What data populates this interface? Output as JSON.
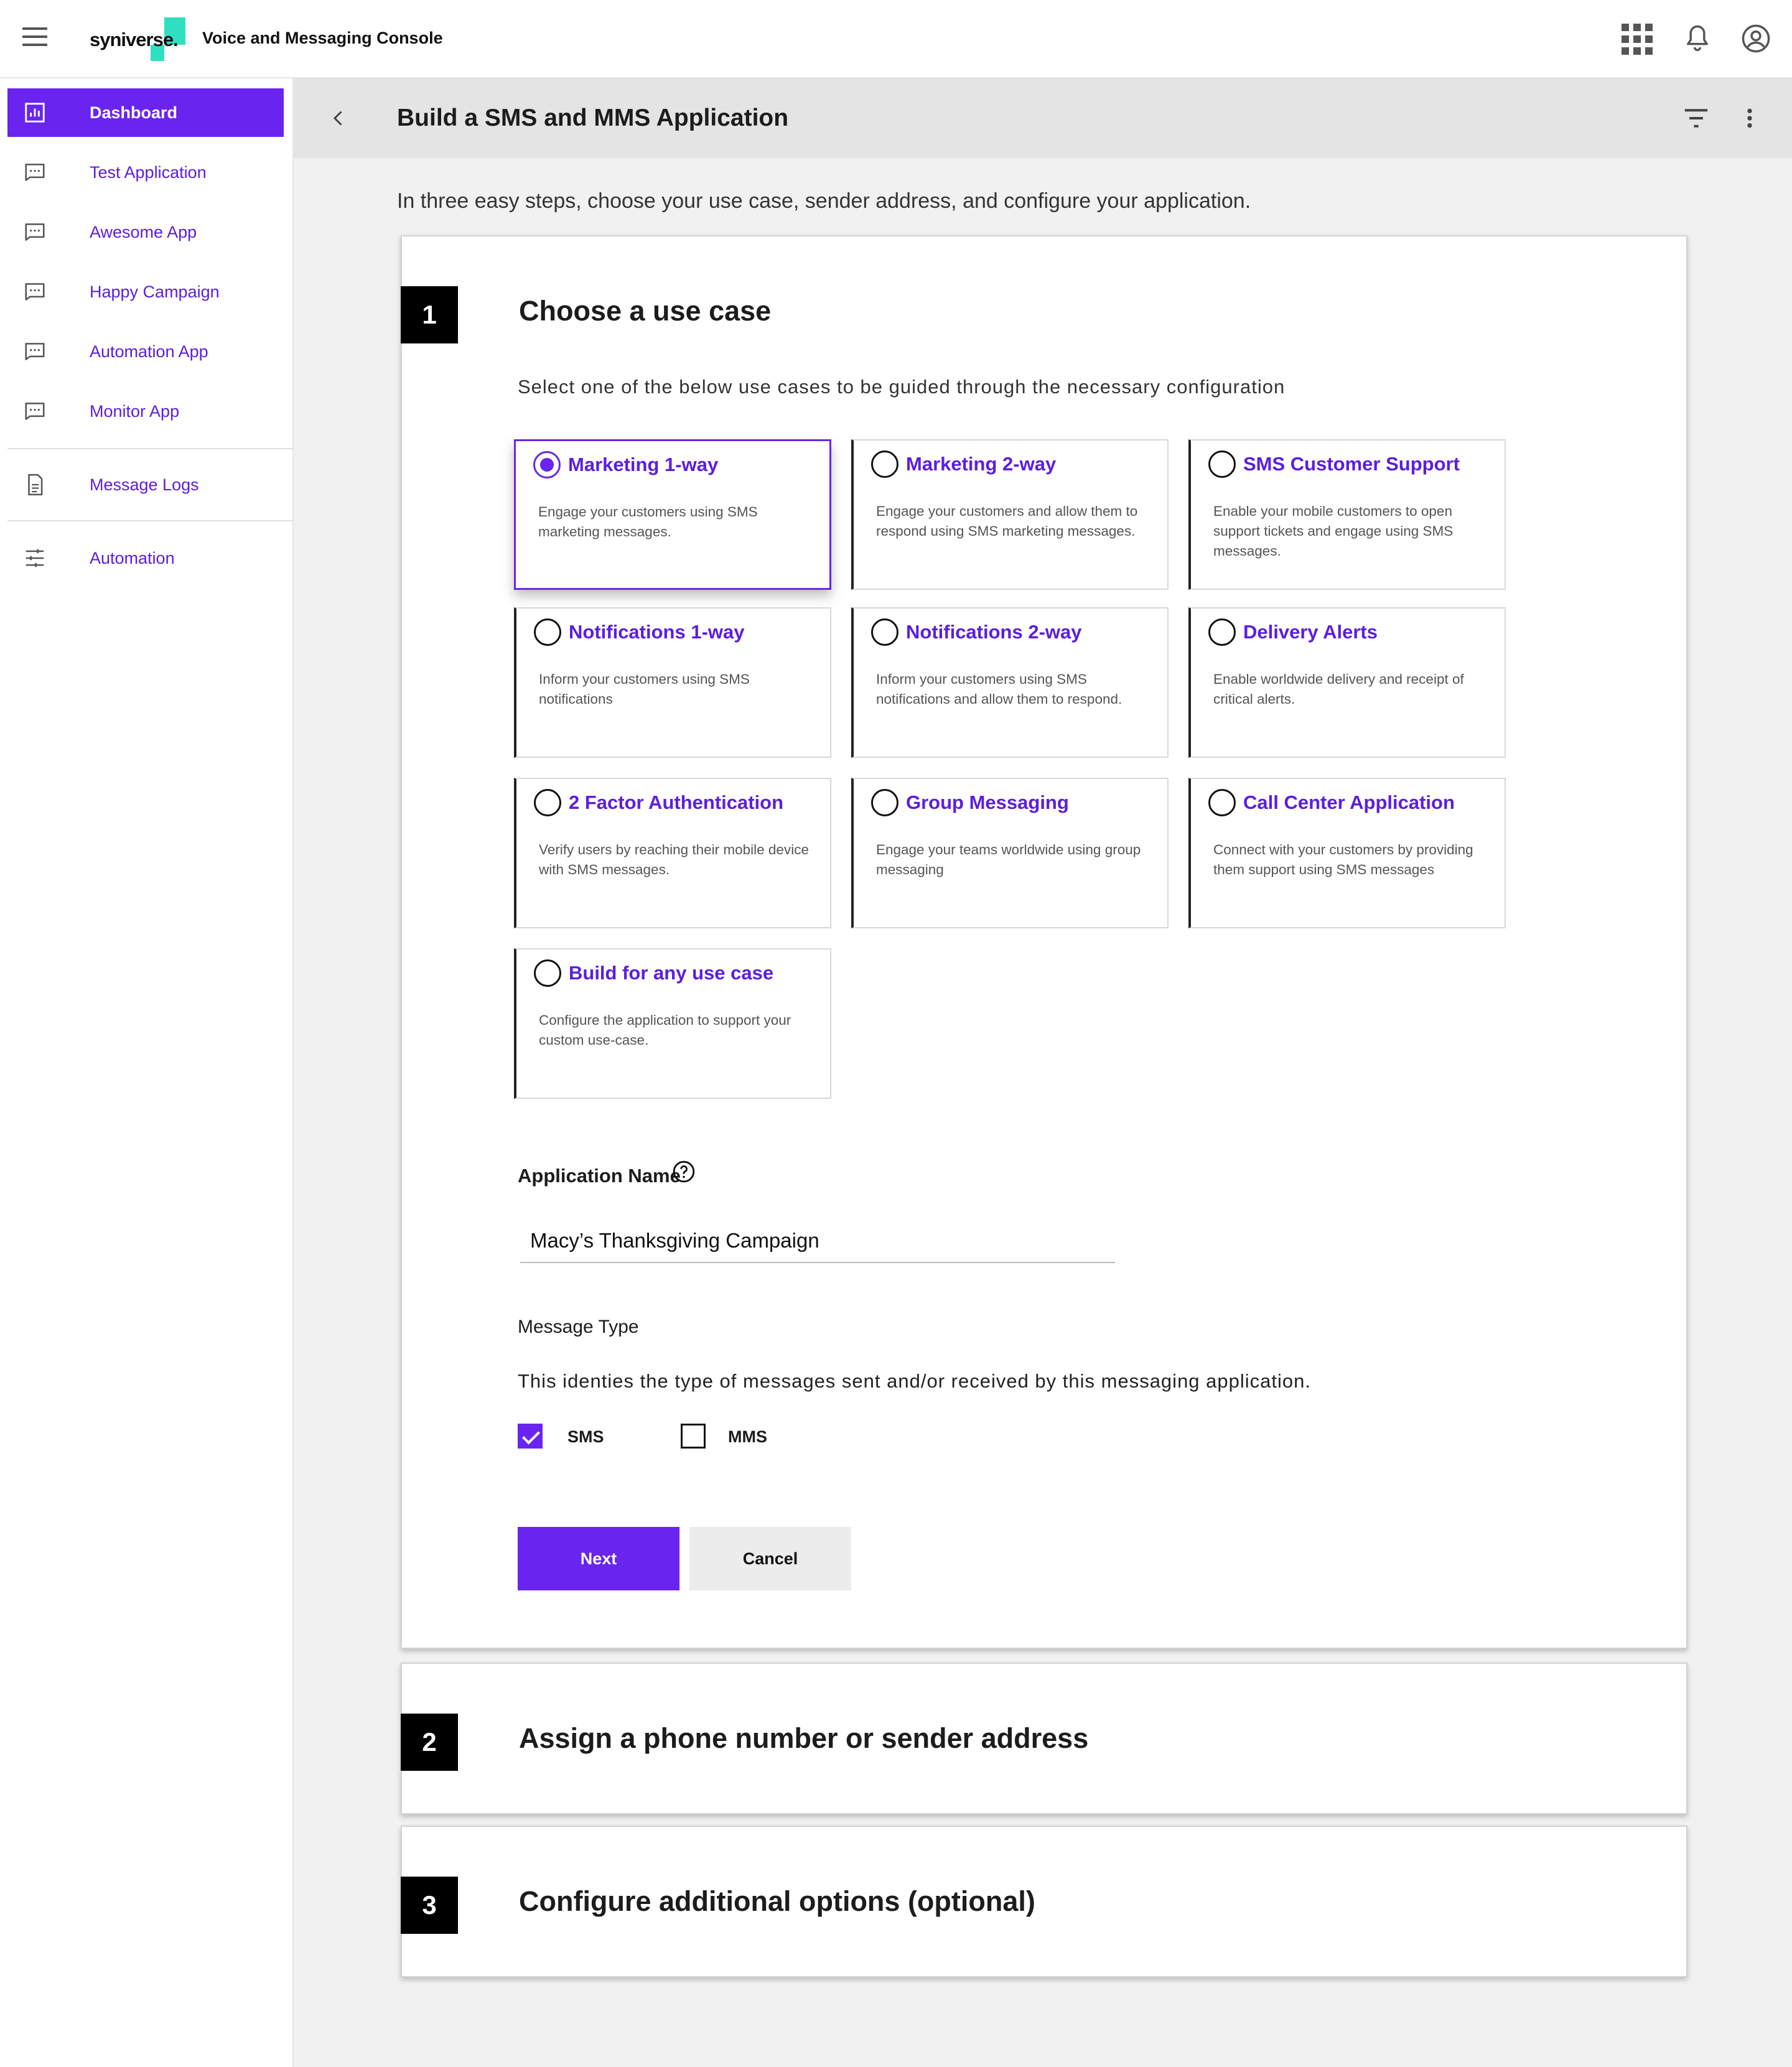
{
  "brand": {
    "logo_text": "syniverse.",
    "console_title": "Voice and Messaging Console",
    "accent": "#6a24f0",
    "logo_color": "#2ee0c0"
  },
  "sidebar": {
    "items": [
      {
        "label": "Dashboard",
        "icon": "bar-chart-icon",
        "active": true
      },
      {
        "label": "Test Application",
        "icon": "message-icon"
      },
      {
        "label": "Awesome App",
        "icon": "message-icon"
      },
      {
        "label": "Happy Campaign",
        "icon": "message-icon"
      },
      {
        "label": "Automation App",
        "icon": "message-icon"
      },
      {
        "label": "Monitor App",
        "icon": "message-icon"
      },
      {
        "label": "Message Logs",
        "icon": "document-icon"
      },
      {
        "label": "Automation",
        "icon": "sliders-icon"
      }
    ]
  },
  "header": {
    "title": "Build a SMS and MMS Application"
  },
  "intro": "In three easy steps, choose your use case, sender address, and configure your application.",
  "step1": {
    "number": "1",
    "title": "Choose a use case",
    "subtitle": "Select one of the below use cases to be guided through the necessary configuration",
    "use_cases": [
      {
        "title": "Marketing 1-way",
        "desc": "Engage your customers using SMS marketing messages.",
        "selected": true
      },
      {
        "title": "Marketing 2-way",
        "desc": "Engage your customers and allow them to respond using SMS marketing messages."
      },
      {
        "title": "SMS Customer Support",
        "desc": "Enable your mobile customers to open support tickets and engage using SMS messages."
      },
      {
        "title": "Notifications 1-way",
        "desc": "Inform your customers using SMS notifications"
      },
      {
        "title": "Notifications 2-way",
        "desc": "Inform your customers using SMS notifications and allow them to respond."
      },
      {
        "title": "Delivery Alerts",
        "desc": "Enable worldwide delivery and receipt of critical alerts."
      },
      {
        "title": "2 Factor Authentication",
        "desc": "Verify users by reaching their mobile device with SMS messages."
      },
      {
        "title": "Group Messaging",
        "desc": "Engage your teams worldwide using group messaging"
      },
      {
        "title": "Call Center Application",
        "desc": "Connect with your customers by providing them support using SMS messages"
      },
      {
        "title": "Build for any use case",
        "desc": "Configure the application to support your custom use-case."
      }
    ],
    "app_name_label": "Application Name",
    "app_name_value": "Macy’s Thanksgiving Campaign",
    "message_type_label": "Message Type",
    "message_type_desc": "This identies the type of messages sent and/or received by this messaging application.",
    "sms_label": "SMS",
    "sms_checked": true,
    "mms_label": "MMS",
    "mms_checked": false,
    "next_label": "Next",
    "cancel_label": "Cancel"
  },
  "step2": {
    "number": "2",
    "title": "Assign a phone number or sender address"
  },
  "step3": {
    "number": "3",
    "title": "Configure additional options (optional)"
  }
}
